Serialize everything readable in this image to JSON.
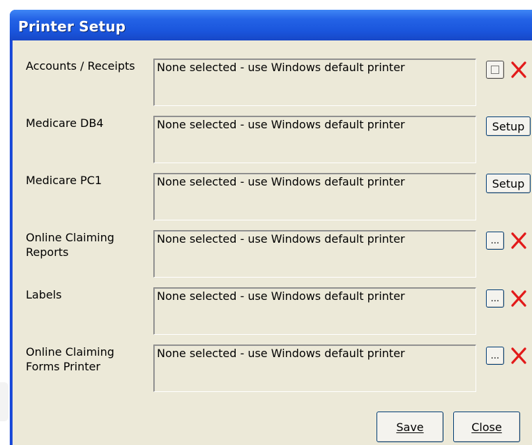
{
  "window": {
    "title": "Printer Setup"
  },
  "rows": [
    {
      "label_lines": [
        "Accounts / Receipts"
      ],
      "value": "None selected - use Windows default printer",
      "button_type": "browse-delete",
      "browse_label": ""
    },
    {
      "label_lines": [
        "Medicare DB4"
      ],
      "value": "None selected - use Windows default printer",
      "button_type": "setup",
      "setup_label": "Setup"
    },
    {
      "label_lines": [
        "Medicare PC1"
      ],
      "value": "None selected - use Windows default printer",
      "button_type": "setup",
      "setup_label": "Setup"
    },
    {
      "label_lines": [
        "Online Claiming",
        "Reports"
      ],
      "value": "None selected - use Windows default printer",
      "button_type": "browse-delete",
      "browse_label": "..."
    },
    {
      "label_lines": [
        "Labels"
      ],
      "value": "None selected - use Windows default printer",
      "button_type": "browse-delete",
      "browse_label": "..."
    },
    {
      "label_lines": [
        "Online Claiming",
        "Forms Printer"
      ],
      "value": "None selected - use Windows default printer",
      "button_type": "browse-delete",
      "browse_label": "..."
    }
  ],
  "footer": {
    "save_label": "Save",
    "close_label": "Close"
  },
  "colors": {
    "title_bar": "#2463e6",
    "dialog_bg": "#ece9d8",
    "delete_icon": "#e21a1a"
  },
  "icons": {
    "delete": "red-x-icon",
    "browse": "ellipsis-icon"
  }
}
